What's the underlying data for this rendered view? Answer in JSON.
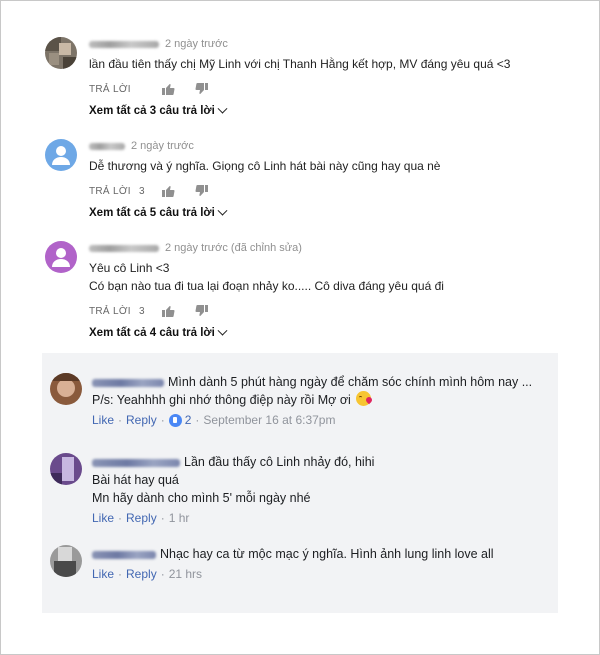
{
  "youtube_comments": [
    {
      "time": "2 ngày trước",
      "lines": [
        "lần đầu tiên thấy chị Mỹ Linh với chị Thanh Hằng kết hợp, MV đáng yêu quá <3"
      ],
      "reply_label": "TRẢ LỜI",
      "like_count": "",
      "view_replies": "Xem tất cả 3 câu trả lời",
      "avatar": "photo-blurred"
    },
    {
      "time": "2 ngày trước",
      "lines": [
        "Dễ thương và ý nghĩa. Giọng cô Linh hát bài này cũng hay qua nè"
      ],
      "reply_label": "TRẢ LỜI",
      "like_count": "3",
      "view_replies": "Xem tất cả 5 câu trả lời",
      "avatar": "default-blue"
    },
    {
      "time": "2 ngày trước (đã chỉnh sửa)",
      "lines": [
        "Yêu cô Linh <3",
        "Có bạn nào tua đi tua lại đoạn nhảy ko..... Cô diva đáng yêu quá đi"
      ],
      "reply_label": "TRẢ LỜI",
      "like_count": "3",
      "view_replies": "Xem tất cả 4 câu trả lời",
      "avatar": "default-purple"
    }
  ],
  "facebook_comments": [
    {
      "lines": [
        "Mình dành 5 phút hàng ngày để chăm sóc chính mình hôm nay ...",
        "P/s: Yeahhhh ghi nhớ thông điệp này rồi Mợ ơi"
      ],
      "like_label": "Like",
      "reply_label": "Reply",
      "reaction_count": "2",
      "time": "September 16 at 6:37pm"
    },
    {
      "lines": [
        "Lần đầu thấy cô Linh nhảy đó, hihi",
        "Bài hát hay quá",
        "Mn hãy dành cho mình 5' mỗi ngày nhé"
      ],
      "like_label": "Like",
      "reply_label": "Reply",
      "time": "1 hr"
    },
    {
      "lines": [
        "Nhạc hay ca từ mộc mạc ý nghĩa. Hình ảnh lung linh love all"
      ],
      "like_label": "Like",
      "reply_label": "Reply",
      "time": "21 hrs"
    }
  ],
  "colors": {
    "fb_link": "#4267b2",
    "yt_avatar_blue": "#6ea8e6",
    "yt_avatar_purple": "#b163c9",
    "fb_panel_bg": "#f2f3f5"
  }
}
